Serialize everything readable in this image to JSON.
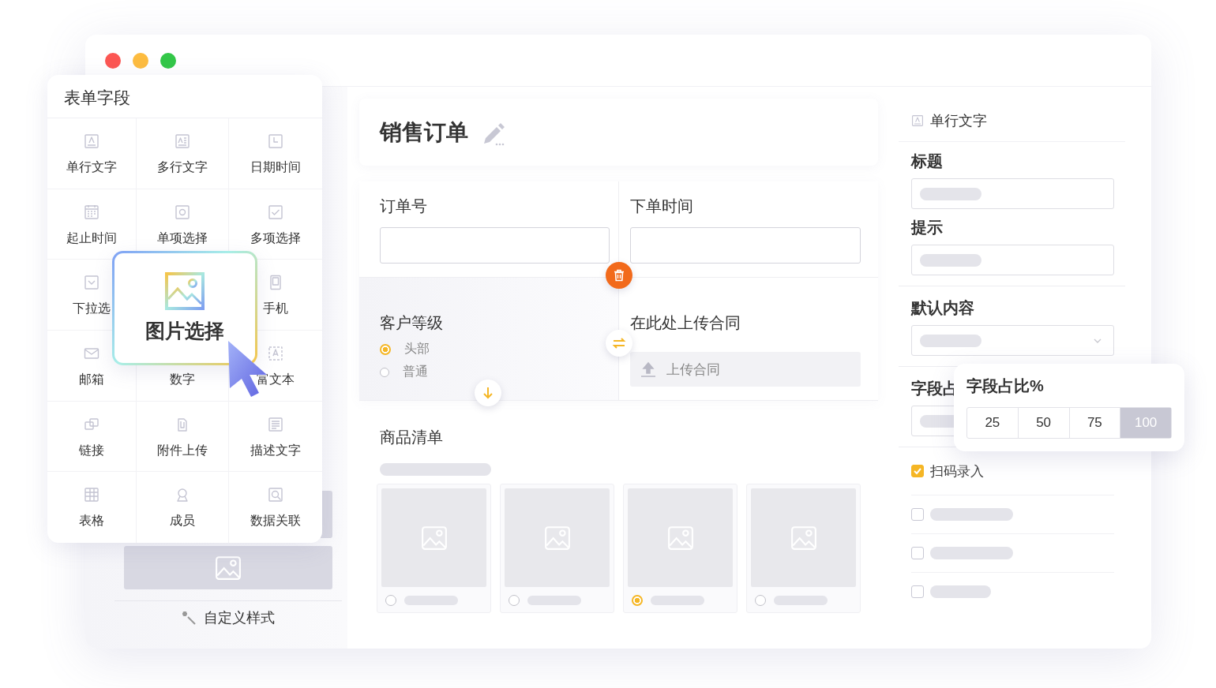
{
  "window": {
    "controls": [
      {
        "color": "#fc5753"
      },
      {
        "color": "#fdbc40"
      },
      {
        "color": "#33c748"
      }
    ]
  },
  "left_panel": {
    "style_button": "自定义样式"
  },
  "form": {
    "title": "销售订单",
    "fields": [
      {
        "kind": "text",
        "label": "订单号"
      },
      {
        "kind": "text",
        "label": "下单时间"
      },
      {
        "kind": "radio",
        "label": "客户等级",
        "options": [
          {
            "label": "头部",
            "selected": true
          },
          {
            "label": "普通",
            "selected": false
          }
        ]
      },
      {
        "kind": "upload",
        "label": "在此处上传合同",
        "button": "上传合同"
      }
    ],
    "product_list": {
      "label": "商品清单",
      "cards": [
        {
          "selected": false
        },
        {
          "selected": false
        },
        {
          "selected": true
        },
        {
          "selected": false
        }
      ]
    }
  },
  "properties": {
    "field_type": "单行文字",
    "title_label": "标题",
    "hint_label": "提示",
    "default_label": "默认内容",
    "width_label": "字段占",
    "checkboxes": [
      {
        "label": "扫码录入",
        "checked": true
      },
      {
        "checked": false
      },
      {
        "checked": false
      },
      {
        "checked": false
      }
    ]
  },
  "width_popover": {
    "title": "字段占比%",
    "options": [
      {
        "label": "25",
        "selected": false
      },
      {
        "label": "50",
        "selected": false
      },
      {
        "label": "75",
        "selected": false
      },
      {
        "label": "100",
        "selected": true
      }
    ]
  },
  "palette": {
    "title": "表单字段",
    "items": [
      {
        "kind": "field",
        "label": "单行文字"
      },
      {
        "kind": "field",
        "label": "多行文字"
      },
      {
        "kind": "field",
        "label": "日期时间"
      },
      {
        "kind": "field",
        "label": "起止时间"
      },
      {
        "kind": "field",
        "label": "单项选择"
      },
      {
        "kind": "field",
        "label": "多项选择"
      },
      {
        "kind": "field",
        "label": "下拉选"
      },
      {
        "kind": "covered"
      },
      {
        "kind": "field",
        "label": "手机"
      },
      {
        "kind": "field",
        "label": "邮箱"
      },
      {
        "kind": "field",
        "label": "数字"
      },
      {
        "kind": "field",
        "label": "富文本"
      },
      {
        "kind": "field",
        "label": "链接"
      },
      {
        "kind": "field",
        "label": "附件上传"
      },
      {
        "kind": "field",
        "label": "描述文字"
      },
      {
        "kind": "field",
        "label": "表格"
      },
      {
        "kind": "field",
        "label": "成员"
      },
      {
        "kind": "field",
        "label": "数据关联"
      }
    ]
  },
  "drag_preview": {
    "label": "图片选择"
  }
}
